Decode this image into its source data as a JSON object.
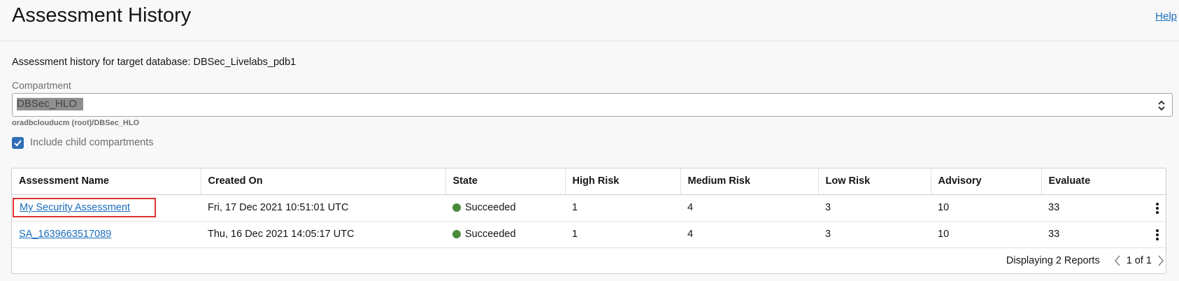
{
  "header": {
    "title": "Assessment History",
    "help_label": "Help"
  },
  "subtitle": "Assessment history for target database: DBSec_Livelabs_pdb1",
  "compartment": {
    "label": "Compartment",
    "value": "DBSec_HLO",
    "path": "oradbclouducm (root)/DBSec_HLO"
  },
  "include_child": {
    "label": "Include child compartments",
    "checked": true
  },
  "table": {
    "columns": [
      "Assessment Name",
      "Created On",
      "State",
      "High Risk",
      "Medium Risk",
      "Low Risk",
      "Advisory",
      "Evaluate"
    ],
    "rows": [
      {
        "name": "My Security Assessment",
        "created_on": "Fri, 17 Dec 2021 10:51:01 UTC",
        "state": "Succeeded",
        "high_risk": "1",
        "medium_risk": "4",
        "low_risk": "3",
        "advisory": "10",
        "evaluate": "33"
      },
      {
        "name": "SA_1639663517089",
        "created_on": "Thu, 16 Dec 2021 14:05:17 UTC",
        "state": "Succeeded",
        "high_risk": "1",
        "medium_risk": "4",
        "low_risk": "3",
        "advisory": "10",
        "evaluate": "33"
      }
    ]
  },
  "footer": {
    "count_text": "Displaying 2 Reports",
    "page_text": "1 of 1"
  },
  "colors": {
    "link": "#1a6dbd",
    "state_succeeded": "#4a8c3a",
    "highlight_border": "#e03232",
    "checkbox": "#2f6fb6"
  },
  "icons": {
    "select": "chevron-up-down-icon",
    "checkbox": "check-icon",
    "row_menu": "kebab-menu-icon",
    "prev": "chevron-left-icon",
    "next": "chevron-right-icon"
  }
}
